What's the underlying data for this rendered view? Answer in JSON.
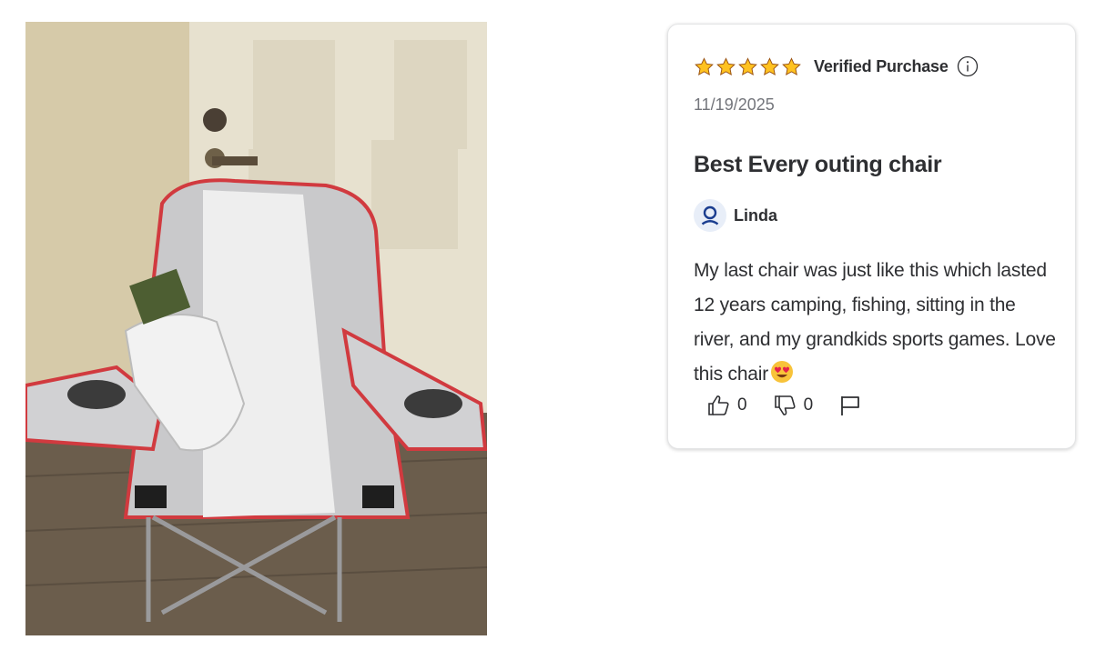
{
  "photo": {
    "alt": "Customer photo of folding camping chair"
  },
  "review": {
    "rating": 5,
    "rating_max": 5,
    "star_color": "#ffc220",
    "verified_label": "Verified Purchase",
    "info_icon": "info-icon",
    "date": "11/19/2025",
    "title": "Best Every outing chair",
    "reviewer_icon": "user-icon",
    "reviewer_name": "Linda",
    "text": "My last chair was just like this which lasted 12 years camping, fishing, sitting in the river, and my grandkids sports games. Love this chair",
    "text_emoji": "heart-eyes-emoji",
    "helpful_count": "0",
    "unhelpful_count": "0",
    "report_icon": "flag-icon"
  }
}
